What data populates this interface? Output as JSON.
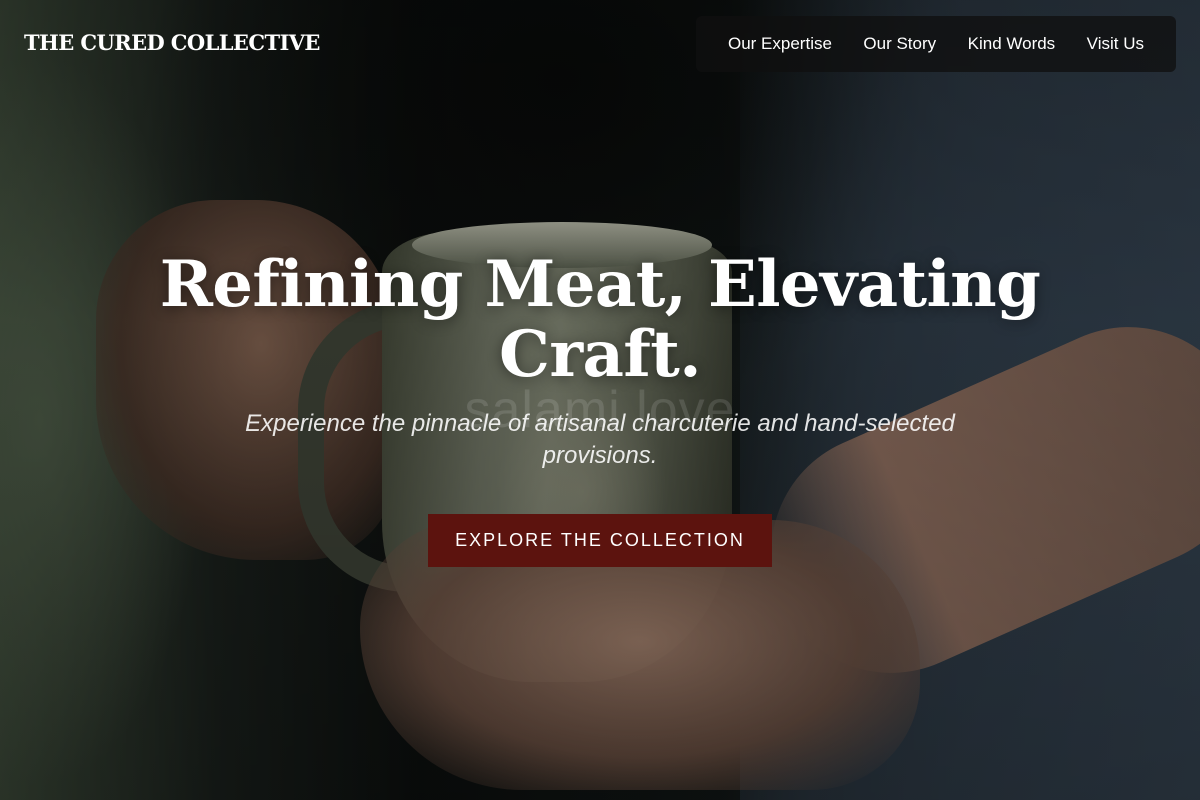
{
  "brand": {
    "logo_text": "THE CURED COLLECTIVE"
  },
  "nav": {
    "items": [
      {
        "label": "Our Expertise"
      },
      {
        "label": "Our Story"
      },
      {
        "label": "Kind Words"
      },
      {
        "label": "Visit Us"
      }
    ]
  },
  "hero": {
    "title_line1": "Refining Meat, Elevating",
    "title_line2": "Craft.",
    "subtitle": "Experience the pinnacle of artisanal charcuterie and hand-selected provisions.",
    "cta_label": "EXPLORE THE COLLECTION",
    "background_watermark": "salami love"
  },
  "colors": {
    "cta_background": "#5c130e",
    "nav_background": "rgba(15,15,15,0.78)",
    "text": "#ffffff"
  }
}
